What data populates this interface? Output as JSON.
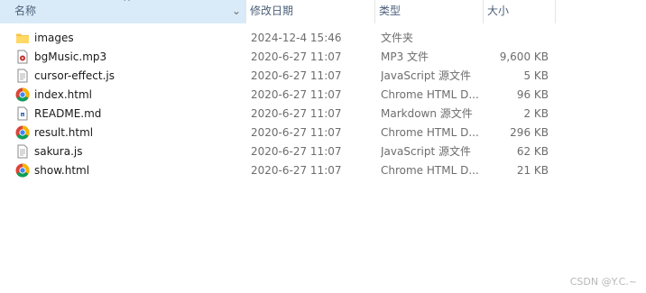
{
  "columns": {
    "name": "名称",
    "date": "修改日期",
    "type": "类型",
    "size": "大小"
  },
  "files": [
    {
      "name": "images",
      "date": "2024-12-4 15:46",
      "type": "文件夹",
      "size": "",
      "icon": "folder-icon"
    },
    {
      "name": "bgMusic.mp3",
      "date": "2020-6-27 11:07",
      "type": "MP3 文件",
      "size": "9,600 KB",
      "icon": "mp3-file-icon"
    },
    {
      "name": "cursor-effect.js",
      "date": "2020-6-27 11:07",
      "type": "JavaScript 源文件",
      "size": "5 KB",
      "icon": "js-file-icon"
    },
    {
      "name": "index.html",
      "date": "2020-6-27 11:07",
      "type": "Chrome HTML D...",
      "size": "96 KB",
      "icon": "chrome-icon"
    },
    {
      "name": "README.md",
      "date": "2020-6-27 11:07",
      "type": "Markdown 源文件",
      "size": "2 KB",
      "icon": "markdown-file-icon"
    },
    {
      "name": "result.html",
      "date": "2020-6-27 11:07",
      "type": "Chrome HTML D...",
      "size": "296 KB",
      "icon": "chrome-icon"
    },
    {
      "name": "sakura.js",
      "date": "2020-6-27 11:07",
      "type": "JavaScript 源文件",
      "size": "62 KB",
      "icon": "js-file-icon"
    },
    {
      "name": "show.html",
      "date": "2020-6-27 11:07",
      "type": "Chrome HTML D...",
      "size": "21 KB",
      "icon": "chrome-icon"
    }
  ],
  "watermark": "CSDN @Y.C.~",
  "colors": {
    "header_sorted_bg": "#d9ebf9",
    "header_text": "#4c607a",
    "folder_yellow": "#f6c54a",
    "secondary_text": "#6d6d6d"
  }
}
